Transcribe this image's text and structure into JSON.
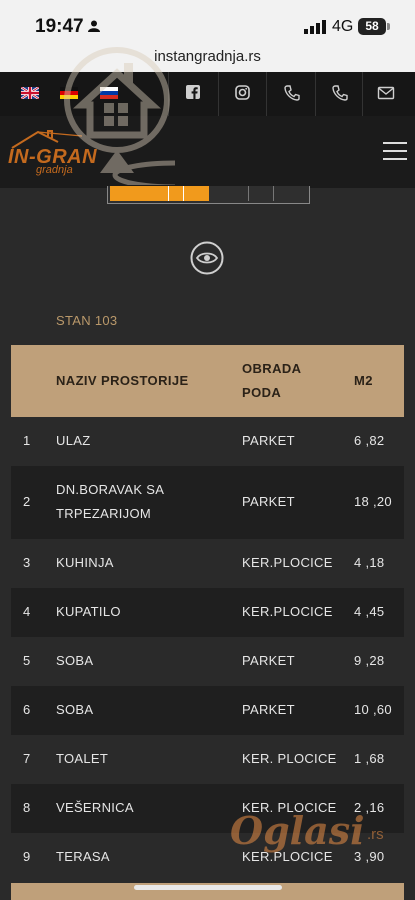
{
  "status_bar": {
    "time": "19:47",
    "network": "4G",
    "battery": "58"
  },
  "browser": {
    "url": "instangradnja.rs"
  },
  "topbar": {
    "languages": [
      "English",
      "German",
      "Russian"
    ],
    "icons": [
      "facebook-icon",
      "instagram-icon",
      "phone-icon",
      "phone-icon",
      "mail-icon"
    ]
  },
  "header": {
    "logo_text": "IN-GRAN",
    "logo_sub": "gradnja"
  },
  "apartment": {
    "label": "STAN 103"
  },
  "table": {
    "headers": {
      "name": [
        "NAZIV PROSTORIJE"
      ],
      "floor": [
        "OBRADA",
        "PODA"
      ],
      "area": [
        "M2"
      ]
    },
    "rows": [
      {
        "no": "1",
        "name": [
          "ULAZ"
        ],
        "floor": "PARKET",
        "area": "6 ,82"
      },
      {
        "no": "2",
        "name": [
          "DN.BORAVAK SA",
          "TRPEZARIJOM"
        ],
        "floor": "PARKET",
        "area": "18 ,20"
      },
      {
        "no": "3",
        "name": [
          "KUHINJA"
        ],
        "floor": "KER.PLOCICE",
        "area": "4 ,18"
      },
      {
        "no": "4",
        "name": [
          "KUPATILO"
        ],
        "floor": "KER.PLOCICE",
        "area": "4 ,45"
      },
      {
        "no": "5",
        "name": [
          "SOBA"
        ],
        "floor": "PARKET",
        "area": "9 ,28"
      },
      {
        "no": "6",
        "name": [
          "SOBA"
        ],
        "floor": "PARKET",
        "area": "10 ,60"
      },
      {
        "no": "7",
        "name": [
          "TOALET"
        ],
        "floor": "KER. PLOCICE",
        "area": "1 ,68"
      },
      {
        "no": "8",
        "name": [
          "VEŠERNICA"
        ],
        "floor": "KER. PLOCICE",
        "area": "2 ,16"
      },
      {
        "no": "9",
        "name": [
          "TERASA"
        ],
        "floor": "KER.PLOCICE",
        "area": "3 ,90"
      }
    ]
  },
  "watermark": {
    "text": "Oglasi",
    "suffix": ".rs"
  },
  "colors": {
    "accent": "#bfa07a",
    "brand_orange": "#c46a1e",
    "background": "#2a2a2a",
    "row_dark": "#1f1f1f"
  }
}
